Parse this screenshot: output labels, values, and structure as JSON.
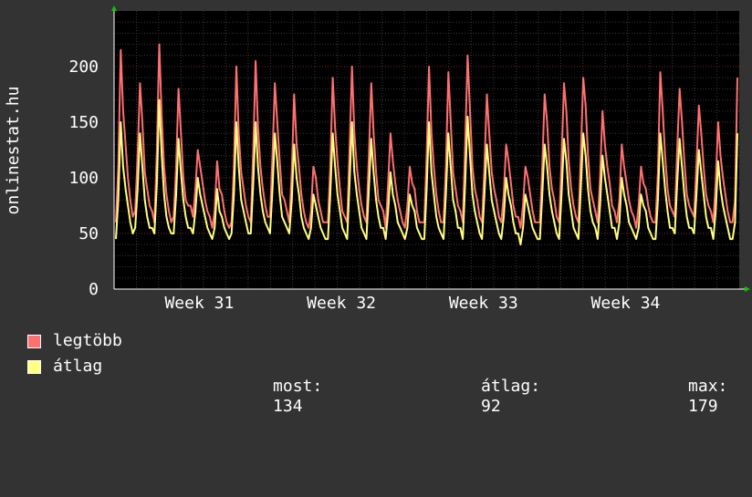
{
  "chart_data": {
    "type": "line",
    "ylabel": "onlinestat.hu",
    "ylim": [
      0,
      250
    ],
    "yticks": [
      0,
      50,
      100,
      150,
      200
    ],
    "xticks": [
      "Week 31",
      "Week 32",
      "Week 33",
      "Week 34"
    ],
    "series": [
      {
        "name": "legtöbb",
        "color": "#ff7070",
        "values": [
          60,
          110,
          215,
          160,
          130,
          100,
          80,
          65,
          70,
          120,
          185,
          150,
          105,
          90,
          75,
          70,
          60,
          125,
          220,
          155,
          110,
          85,
          70,
          60,
          65,
          110,
          180,
          140,
          100,
          80,
          75,
          75,
          65,
          90,
          125,
          110,
          95,
          80,
          70,
          65,
          55,
          70,
          115,
          90,
          85,
          70,
          60,
          55,
          60,
          110,
          200,
          140,
          105,
          90,
          75,
          65,
          60,
          125,
          205,
          145,
          110,
          90,
          75,
          65,
          65,
          120,
          185,
          150,
          115,
          85,
          80,
          70,
          60,
          105,
          175,
          130,
          110,
          85,
          70,
          60,
          55,
          70,
          110,
          100,
          80,
          70,
          60,
          60,
          60,
          110,
          190,
          145,
          115,
          90,
          70,
          65,
          60,
          125,
          200,
          140,
          110,
          90,
          75,
          65,
          60,
          120,
          185,
          140,
          105,
          80,
          75,
          70,
          55,
          95,
          140,
          115,
          95,
          80,
          70,
          60,
          55,
          75,
          110,
          95,
          90,
          70,
          60,
          60,
          60,
          120,
          200,
          140,
          110,
          85,
          70,
          60,
          60,
          110,
          195,
          150,
          105,
          90,
          75,
          70,
          60,
          130,
          210,
          160,
          110,
          90,
          80,
          65,
          60,
          110,
          175,
          140,
          105,
          90,
          80,
          65,
          60,
          85,
          130,
          115,
          95,
          75,
          65,
          65,
          55,
          75,
          110,
          100,
          85,
          70,
          60,
          60,
          60,
          110,
          175,
          150,
          110,
          90,
          80,
          65,
          60,
          115,
          185,
          160,
          115,
          90,
          75,
          65,
          60,
          120,
          190,
          165,
          120,
          90,
          80,
          70,
          60,
          100,
          160,
          130,
          110,
          95,
          75,
          70,
          60,
          80,
          130,
          110,
          95,
          80,
          70,
          65,
          55,
          75,
          110,
          95,
          90,
          75,
          65,
          60,
          60,
          105,
          195,
          160,
          120,
          90,
          75,
          70,
          65,
          125,
          180,
          150,
          115,
          85,
          75,
          70,
          65,
          110,
          165,
          140,
          110,
          85,
          75,
          70,
          60,
          95,
          150,
          120,
          100,
          85,
          70,
          60,
          60,
          80,
          190
        ]
      },
      {
        "name": "átlag",
        "color": "#ffff80",
        "values": [
          45,
          80,
          150,
          110,
          90,
          75,
          60,
          50,
          55,
          90,
          140,
          110,
          80,
          65,
          55,
          55,
          50,
          95,
          170,
          120,
          85,
          65,
          55,
          50,
          50,
          85,
          135,
          105,
          80,
          65,
          55,
          55,
          50,
          70,
          100,
          85,
          75,
          65,
          55,
          50,
          45,
          55,
          90,
          70,
          65,
          55,
          50,
          45,
          50,
          85,
          150,
          110,
          80,
          70,
          60,
          50,
          50,
          95,
          150,
          110,
          85,
          70,
          60,
          55,
          50,
          90,
          140,
          115,
          85,
          65,
          60,
          55,
          50,
          80,
          130,
          100,
          85,
          65,
          55,
          50,
          45,
          55,
          85,
          75,
          65,
          55,
          50,
          45,
          45,
          85,
          140,
          110,
          85,
          70,
          55,
          50,
          45,
          95,
          150,
          105,
          85,
          70,
          55,
          50,
          45,
          90,
          135,
          105,
          80,
          65,
          55,
          55,
          45,
          70,
          105,
          85,
          75,
          60,
          55,
          50,
          45,
          55,
          85,
          75,
          70,
          55,
          50,
          45,
          45,
          90,
          150,
          105,
          85,
          65,
          55,
          50,
          45,
          85,
          140,
          110,
          80,
          70,
          55,
          55,
          45,
          95,
          155,
          120,
          85,
          70,
          60,
          50,
          45,
          85,
          130,
          105,
          80,
          70,
          60,
          50,
          45,
          65,
          100,
          85,
          75,
          60,
          50,
          50,
          40,
          55,
          85,
          75,
          65,
          55,
          50,
          45,
          45,
          85,
          130,
          110,
          85,
          70,
          60,
          50,
          45,
          85,
          135,
          115,
          85,
          70,
          55,
          50,
          45,
          90,
          140,
          120,
          90,
          70,
          60,
          55,
          45,
          75,
          120,
          100,
          85,
          70,
          55,
          55,
          45,
          60,
          100,
          85,
          75,
          60,
          55,
          50,
          45,
          55,
          85,
          75,
          70,
          55,
          50,
          45,
          45,
          80,
          140,
          115,
          90,
          70,
          55,
          55,
          50,
          95,
          135,
          110,
          85,
          65,
          55,
          55,
          50,
          85,
          125,
          105,
          85,
          65,
          55,
          55,
          45,
          70,
          115,
          90,
          75,
          65,
          55,
          45,
          45,
          60,
          140
        ]
      }
    ],
    "legend": {
      "most_label": "most:",
      "most_value": "134",
      "atlag_label": "átlag:",
      "atlag_value": "92",
      "max_label": "max:",
      "max_value": "179"
    },
    "grid": true
  }
}
